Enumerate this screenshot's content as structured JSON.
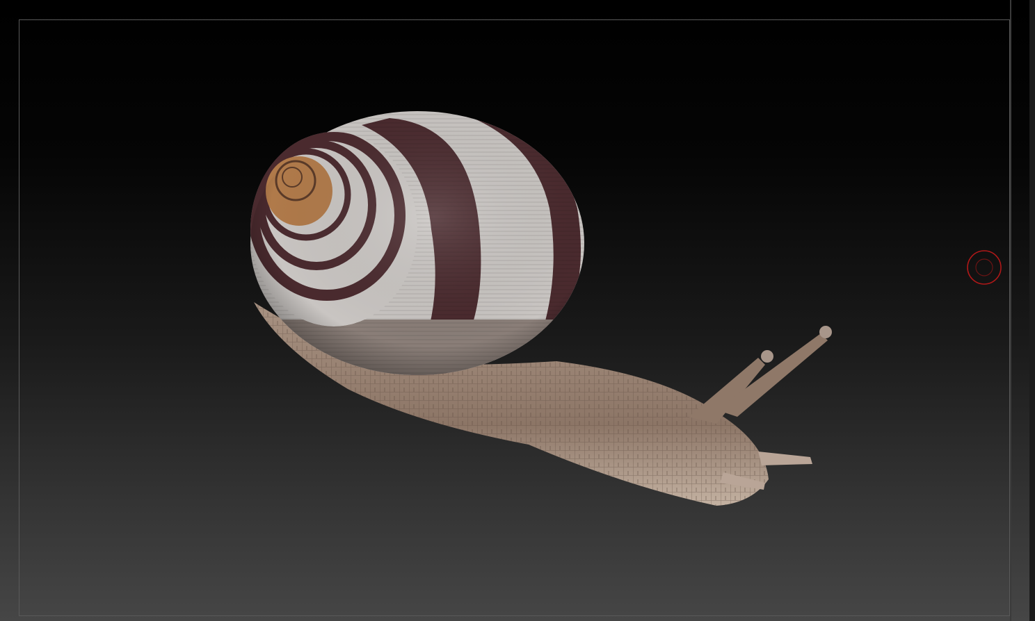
{
  "viewport": {
    "model_name": "snail",
    "colors": {
      "shell_light": "#c9c5c2",
      "shell_dark": "#4a2a2e",
      "apex": "#b07a4a",
      "body": "#9b8574",
      "cursor": "#b01818"
    }
  },
  "icons": {
    "brush_cursor": "circle-brush-cursor"
  }
}
